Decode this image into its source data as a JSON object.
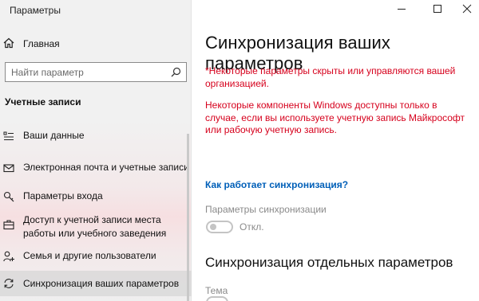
{
  "window": {
    "title": "Параметры",
    "controls": [
      "minimize-icon",
      "maximize-icon",
      "close-icon"
    ]
  },
  "nav": {
    "home_label": "Главная",
    "search_placeholder": "Найти параметр",
    "section_title": "Учетные записи",
    "items": [
      {
        "icon": "user-details-icon",
        "label": "Ваши данные"
      },
      {
        "icon": "mail-icon",
        "label": "Электронная почта и учетные записи"
      },
      {
        "icon": "key-icon",
        "label": "Параметры входа"
      },
      {
        "icon": "briefcase-icon",
        "label": "Доступ к учетной записи места работы или учебного заведения"
      },
      {
        "icon": "person-add-icon",
        "label": "Семья и другие пользователи"
      },
      {
        "icon": "sync-icon",
        "label": "Синхронизация ваших параметров",
        "active": true
      }
    ]
  },
  "main": {
    "title": "Синхронизация ваших параметров",
    "warning_1": "*Некоторые параметры скрыты или управляются вашей организацией.",
    "warning_2": "Некоторые компоненты Windows доступны только в случае, если вы используете учетную запись Майкрософт или рабочую учетную запись.",
    "link_label": "Как работает синхронизация?",
    "sync_settings_label": "Параметры синхронизации",
    "sync_toggle_state": "Откл.",
    "sync_toggle_on": false,
    "individual_title": "Синхронизация отдельных параметров",
    "theme_label": "Тема"
  },
  "colors": {
    "warning": "#d6001c",
    "link": "#005fb8",
    "muted": "#8a8a8a"
  }
}
